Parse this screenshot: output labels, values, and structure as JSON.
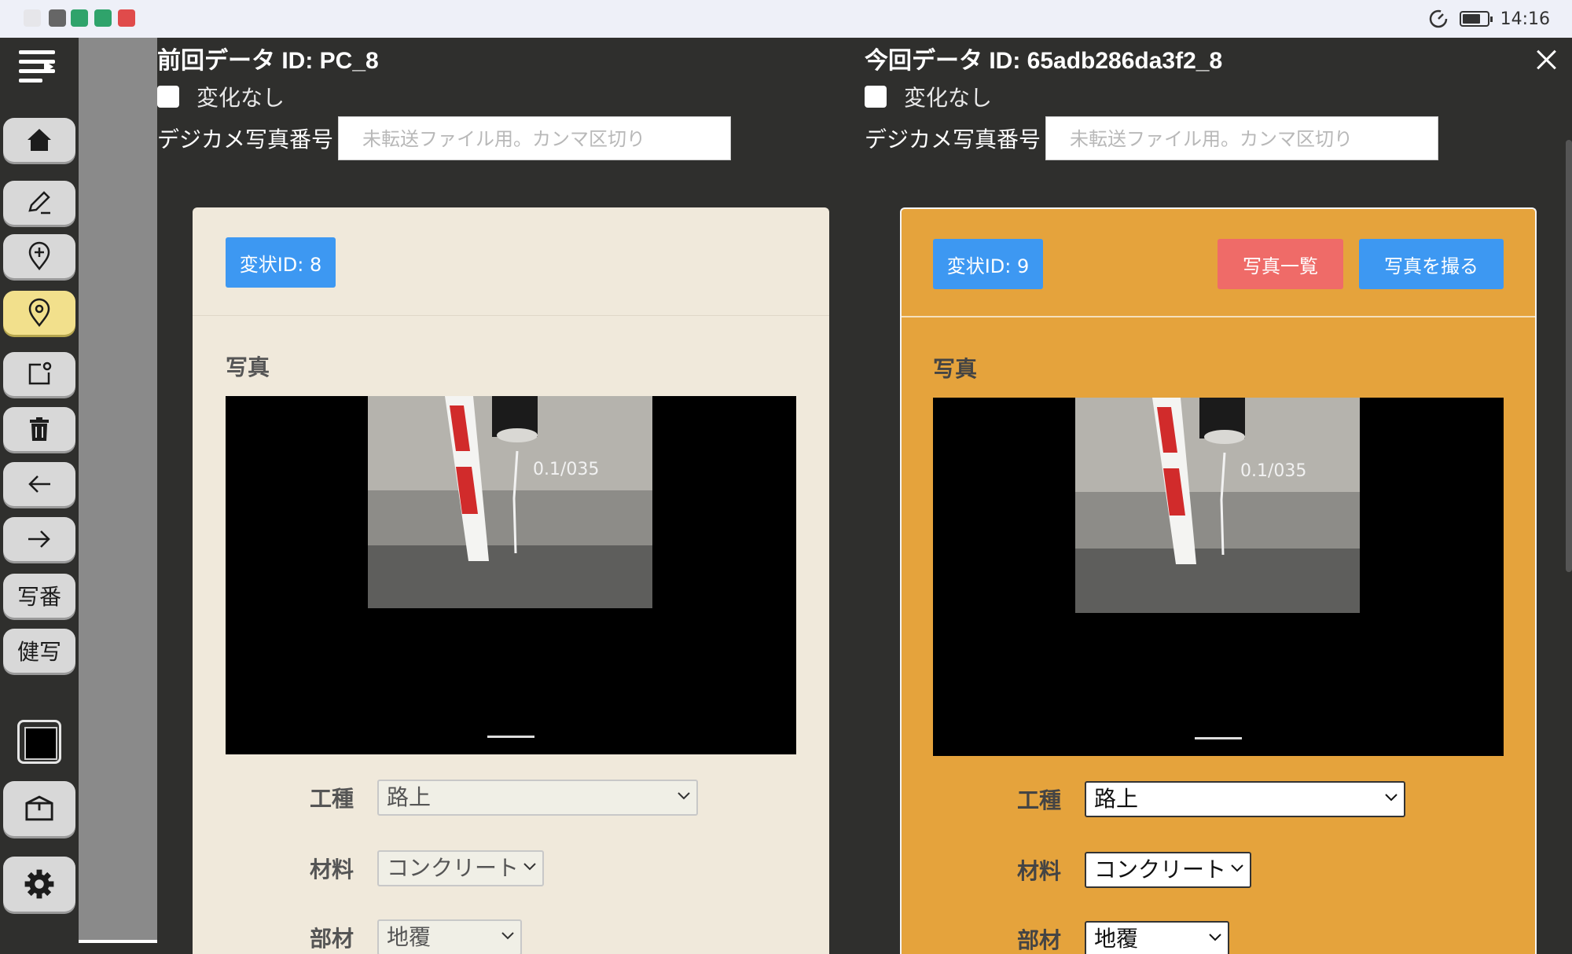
{
  "status": {
    "time": "14:16"
  },
  "toolbar": {
    "photo_number_label": "写番",
    "health_photo_label": "健写"
  },
  "left": {
    "data_id": "前回データ ID: PC_8",
    "no_change_label": "変化なし",
    "photo_number_label": "デジカメ写真番号",
    "photo_number_placeholder": "未転送ファイル用。カンマ区切り",
    "defect_id": "変状ID: 8",
    "photo_section": "写真",
    "fields": {
      "work_type_label": "工種",
      "work_type_value": "路上",
      "material_label": "材料",
      "material_value": "コンクリート",
      "member_label": "部材",
      "member_value": "地覆"
    }
  },
  "right": {
    "data_id": "今回データ ID: 65adb286da3f2_8",
    "no_change_label": "変化なし",
    "photo_number_label": "デジカメ写真番号",
    "photo_number_placeholder": "未転送ファイル用。カンマ区切り",
    "defect_id": "変状ID: 9",
    "photo_list_button": "写真一覧",
    "take_photo_button": "写真を撮る",
    "photo_section": "写真",
    "fields": {
      "work_type_label": "工種",
      "work_type_value": "路上",
      "material_label": "材料",
      "material_value": "コンクリート",
      "member_label": "部材",
      "member_value": "地覆"
    }
  },
  "colors": {
    "toolbar_bg": "#2f2f2d",
    "prev_card_bg": "#f0e9db",
    "curr_card_bg": "#e5a33c",
    "button_blue": "#3d98f2",
    "button_red": "#ef6b68",
    "active_tool": "#f2e08c"
  },
  "icons": [
    "menu-icon",
    "home-icon",
    "pen-icon",
    "pin-plus-icon",
    "pin-icon",
    "note-icon",
    "trash-icon",
    "arrow-left-icon",
    "arrow-right-icon",
    "box-icon",
    "gear-icon",
    "close-icon"
  ]
}
